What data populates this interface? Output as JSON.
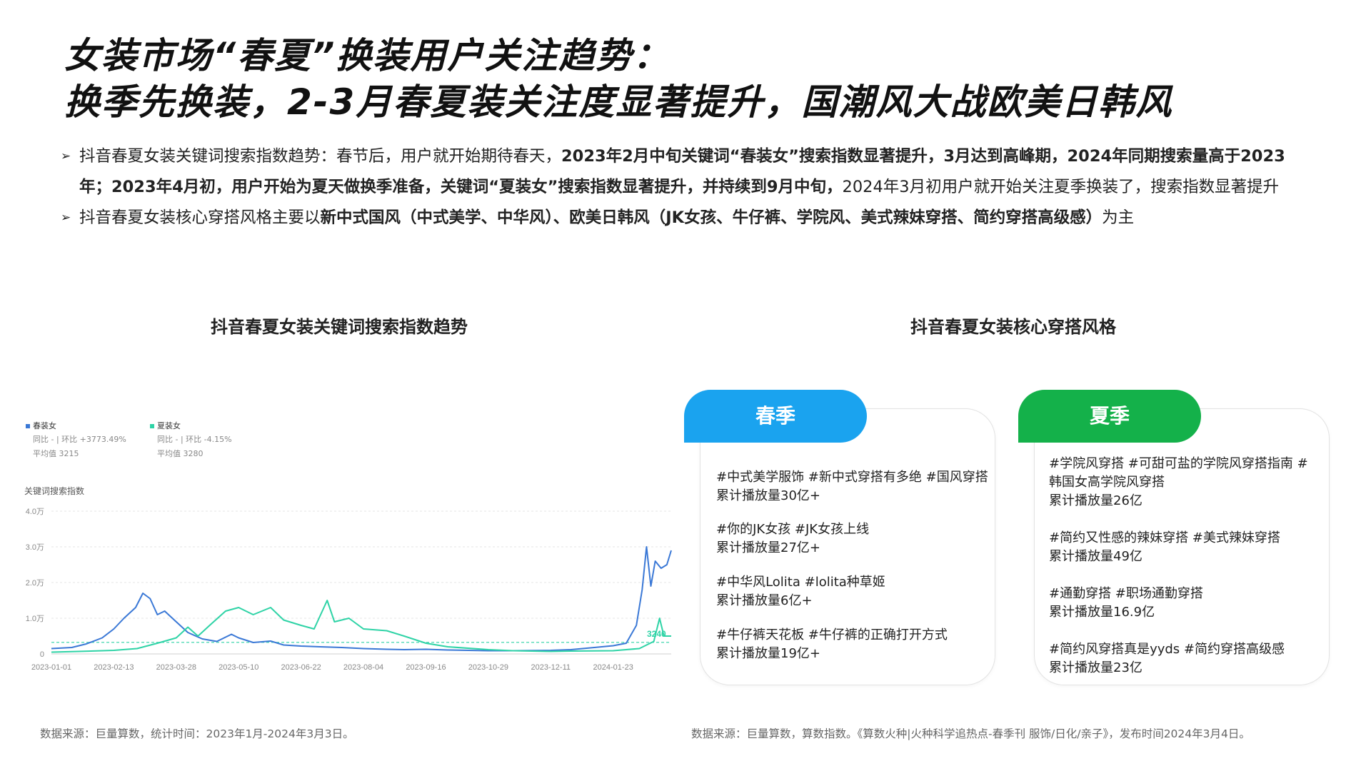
{
  "title_line1": "女装市场“春夏”换装用户关注趋势：",
  "title_line2": "换季先换装，2-3月春夏装关注度显著提升，国潮风大战欧美日韩风",
  "bullets": {
    "b1_text1": "抖音春夏女装关键词搜索指数趋势：春节后，用户就开始期待春天，",
    "b1_bold1": "2023年2月中旬关键词“春装女”搜索指数显著提升，3月达到高峰期，2024年同期搜索量高于2023年；2023年4月初，用户开始为夏天做换季准备，关键词“夏装女”搜索指数显著提升，并持续到9月中旬，",
    "b1_text2": "2024年3月初用户就开始关注夏季换装了，搜索指数显著提升",
    "b2_text1": "抖音春夏女装核心穿搭风格主要以",
    "b2_bold1": "新中式国风（中式美学、中华风）、欧美日韩风（JK女孩、牛仔裤、学院风、美式辣妹穿搭、简约穿搭高级感）",
    "b2_text2": "为主"
  },
  "left_title": "抖音春夏女装关键词搜索指数趋势",
  "right_title": "抖音春夏女装核心穿搭风格",
  "legend": {
    "s1_name": "春装女",
    "s1_change": "同比 - | 环比 +3773.49%",
    "s1_avg": "平均值 3215",
    "s2_name": "夏装女",
    "s2_change": "同比 - | 环比 -4.15%",
    "s2_avg": "平均值 3280"
  },
  "colors": {
    "spring": "#3a78d6",
    "summer": "#2ed3a6",
    "spring_tab": "#1aa3ef",
    "summer_tab": "#14b14a"
  },
  "chart_data": {
    "type": "line",
    "ylabel": "关键词搜索指数",
    "yticks": [
      "4.0万",
      "3.0万",
      "2.0万",
      "1.0万",
      "0"
    ],
    "ylim": [
      0,
      40000
    ],
    "xticks": [
      "2023-01-01",
      "2023-02-13",
      "2023-03-28",
      "2023-05-10",
      "2023-06-22",
      "2023-08-04",
      "2023-09-16",
      "2023-10-29",
      "2023-12-11",
      "2024-01-23"
    ],
    "x_start": "2023-01-01",
    "x_end": "2024-03-03",
    "end_label": "3240",
    "avg_line": 3240,
    "series": [
      {
        "name": "春装女",
        "points": [
          [
            "2023-01-01",
            1500
          ],
          [
            "2023-01-15",
            1800
          ],
          [
            "2023-01-25",
            2800
          ],
          [
            "2023-02-05",
            4500
          ],
          [
            "2023-02-13",
            7000
          ],
          [
            "2023-02-20",
            10000
          ],
          [
            "2023-02-28",
            13000
          ],
          [
            "2023-03-05",
            17000
          ],
          [
            "2023-03-10",
            15500
          ],
          [
            "2023-03-15",
            11000
          ],
          [
            "2023-03-20",
            12000
          ],
          [
            "2023-03-28",
            9000
          ],
          [
            "2023-04-05",
            6000
          ],
          [
            "2023-04-15",
            4200
          ],
          [
            "2023-04-25",
            3500
          ],
          [
            "2023-05-05",
            5500
          ],
          [
            "2023-05-10",
            4500
          ],
          [
            "2023-05-20",
            3200
          ],
          [
            "2023-06-01",
            3600
          ],
          [
            "2023-06-10",
            2500
          ],
          [
            "2023-06-22",
            2200
          ],
          [
            "2023-07-05",
            2000
          ],
          [
            "2023-07-20",
            1800
          ],
          [
            "2023-08-04",
            1500
          ],
          [
            "2023-08-20",
            1300
          ],
          [
            "2023-09-01",
            1200
          ],
          [
            "2023-09-16",
            1300
          ],
          [
            "2023-10-01",
            1100
          ],
          [
            "2023-10-29",
            900
          ],
          [
            "2023-11-15",
            900
          ],
          [
            "2023-12-11",
            1000
          ],
          [
            "2023-12-25",
            1200
          ],
          [
            "2024-01-10",
            1800
          ],
          [
            "2024-01-23",
            2300
          ],
          [
            "2024-02-01",
            3000
          ],
          [
            "2024-02-08",
            8000
          ],
          [
            "2024-02-12",
            18000
          ],
          [
            "2024-02-15",
            30000
          ],
          [
            "2024-02-18",
            19000
          ],
          [
            "2024-02-21",
            26000
          ],
          [
            "2024-02-25",
            24000
          ],
          [
            "2024-02-29",
            25000
          ],
          [
            "2024-03-03",
            29000
          ]
        ]
      },
      {
        "name": "夏装女",
        "points": [
          [
            "2023-01-01",
            500
          ],
          [
            "2023-01-20",
            700
          ],
          [
            "2023-02-13",
            1000
          ],
          [
            "2023-03-01",
            1500
          ],
          [
            "2023-03-15",
            3000
          ],
          [
            "2023-03-28",
            4500
          ],
          [
            "2023-04-05",
            7500
          ],
          [
            "2023-04-12",
            5000
          ],
          [
            "2023-04-20",
            8000
          ],
          [
            "2023-05-01",
            12000
          ],
          [
            "2023-05-10",
            13000
          ],
          [
            "2023-05-20",
            11000
          ],
          [
            "2023-06-01",
            13000
          ],
          [
            "2023-06-10",
            9500
          ],
          [
            "2023-06-22",
            8000
          ],
          [
            "2023-07-01",
            7000
          ],
          [
            "2023-07-10",
            15000
          ],
          [
            "2023-07-15",
            9000
          ],
          [
            "2023-07-25",
            10000
          ],
          [
            "2023-08-04",
            7000
          ],
          [
            "2023-08-20",
            6500
          ],
          [
            "2023-09-01",
            5000
          ],
          [
            "2023-09-16",
            3000
          ],
          [
            "2023-10-01",
            2000
          ],
          [
            "2023-10-29",
            1200
          ],
          [
            "2023-11-15",
            900
          ],
          [
            "2023-12-11",
            700
          ],
          [
            "2023-12-25",
            800
          ],
          [
            "2024-01-23",
            900
          ],
          [
            "2024-02-10",
            1500
          ],
          [
            "2024-02-20",
            3500
          ],
          [
            "2024-02-24",
            10000
          ],
          [
            "2024-02-27",
            5000
          ],
          [
            "2024-03-03",
            5000
          ]
        ]
      }
    ]
  },
  "spring_card": {
    "label": "春季",
    "e1_tags": "#中式美学服饰 #新中式穿搭有多绝 #国风穿搭",
    "e1_count": "累计播放量30亿+",
    "e2_tags": "#你的JK女孩 #JK女孩上线",
    "e2_count": "累计播放量27亿+",
    "e3_tags": "#中华风Lolita #lolita种草姬",
    "e3_count": "累计播放量6亿+",
    "e4_tags": "#牛仔裤天花板 #牛仔裤的正确打开方式",
    "e4_count": "累计播放量19亿+"
  },
  "summer_card": {
    "label": "夏季",
    "e1_tags": "#学院风穿搭 #可甜可盐的学院风穿搭指南 #韩国女高学院风穿搭",
    "e1_count": "累计播放量26亿",
    "e2_tags": "#简约又性感的辣妹穿搭 #美式辣妹穿搭",
    "e2_count": "累计播放量49亿",
    "e3_tags": "#通勤穿搭 #职场通勤穿搭",
    "e3_count": "累计播放量16.9亿",
    "e4_tags": "#简约风穿搭真是yyds #简约穿搭高级感",
    "e4_count": "累计播放量23亿"
  },
  "source_left": "数据来源：巨量算数，统计时间：2023年1月-2024年3月3日。",
  "source_right": "数据来源：巨量算数，算数指数。《算数火种|火种科学追热点-春季刊 服饰/日化/亲子》，发布时间2024年3月4日。"
}
